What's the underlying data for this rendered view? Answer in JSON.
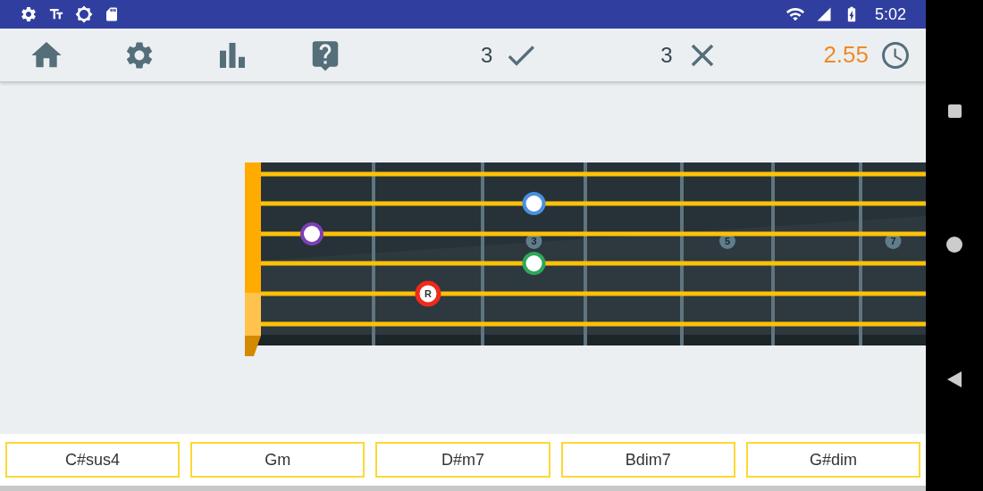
{
  "status_bar": {
    "time": "5:02"
  },
  "toolbar": {
    "correct_count": "3",
    "wrong_count": "3",
    "timer": "2.55"
  },
  "fretboard": {
    "markers": [
      {
        "fret": "3"
      },
      {
        "fret": "5"
      },
      {
        "fret": "7"
      }
    ],
    "strings": [
      {
        "cells": [
          {
            "kind": "empty"
          },
          {
            "kind": "empty"
          },
          {
            "kind": "empty"
          },
          {
            "kind": "empty"
          },
          {
            "kind": "empty"
          },
          {
            "kind": "empty"
          },
          {
            "kind": "empty"
          }
        ]
      },
      {
        "cells": [
          {
            "kind": "empty"
          },
          {
            "kind": "empty"
          },
          {
            "kind": "note",
            "color": "#4a8fe0"
          },
          {
            "kind": "empty"
          },
          {
            "kind": "empty"
          },
          {
            "kind": "empty"
          },
          {
            "kind": "empty"
          }
        ]
      },
      {
        "cells": [
          {
            "kind": "note",
            "color": "#7e3fb3"
          },
          {
            "kind": "empty"
          },
          {
            "kind": "empty"
          },
          {
            "kind": "empty"
          },
          {
            "kind": "empty"
          },
          {
            "kind": "empty"
          },
          {
            "kind": "empty"
          }
        ]
      },
      {
        "cells": [
          {
            "kind": "empty"
          },
          {
            "kind": "empty"
          },
          {
            "kind": "note",
            "color": "#2ea75a"
          },
          {
            "kind": "empty"
          },
          {
            "kind": "empty"
          },
          {
            "kind": "empty"
          },
          {
            "kind": "empty"
          }
        ]
      },
      {
        "cells": [
          {
            "kind": "empty"
          },
          {
            "kind": "root",
            "color": "#ee2b1b",
            "label": "R"
          },
          {
            "kind": "empty"
          },
          {
            "kind": "empty"
          },
          {
            "kind": "empty"
          },
          {
            "kind": "empty"
          },
          {
            "kind": "empty"
          }
        ]
      },
      {
        "cells": [
          {
            "kind": "empty"
          },
          {
            "kind": "empty"
          },
          {
            "kind": "empty"
          },
          {
            "kind": "empty"
          },
          {
            "kind": "empty"
          },
          {
            "kind": "empty"
          },
          {
            "kind": "empty"
          }
        ]
      }
    ]
  },
  "answers": [
    {
      "label": "C#sus4"
    },
    {
      "label": "Gm"
    },
    {
      "label": "D#m7"
    },
    {
      "label": "Bdim7"
    },
    {
      "label": "G#dim"
    }
  ]
}
